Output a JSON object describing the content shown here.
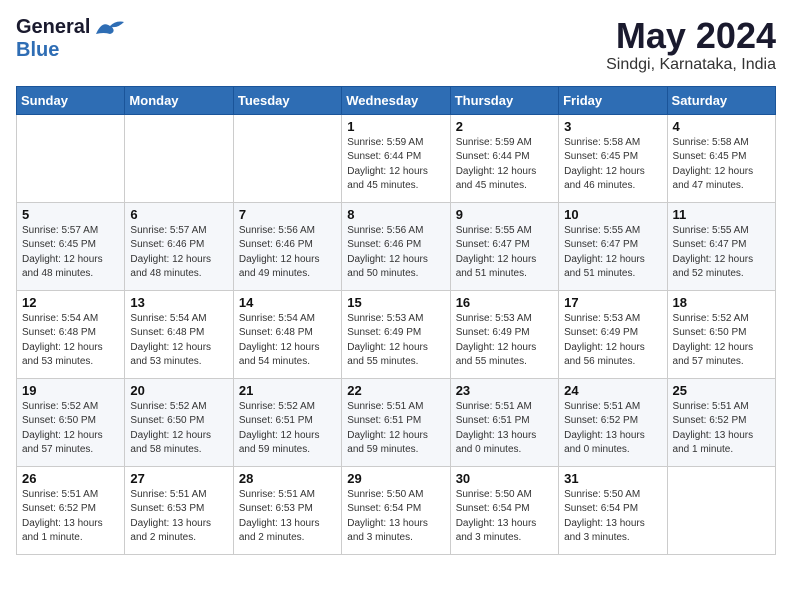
{
  "header": {
    "logo_general": "General",
    "logo_blue": "Blue",
    "month_title": "May 2024",
    "location": "Sindgi, Karnataka, India"
  },
  "days_of_week": [
    "Sunday",
    "Monday",
    "Tuesday",
    "Wednesday",
    "Thursday",
    "Friday",
    "Saturday"
  ],
  "weeks": [
    [
      {
        "day": "",
        "info": ""
      },
      {
        "day": "",
        "info": ""
      },
      {
        "day": "",
        "info": ""
      },
      {
        "day": "1",
        "info": "Sunrise: 5:59 AM\nSunset: 6:44 PM\nDaylight: 12 hours\nand 45 minutes."
      },
      {
        "day": "2",
        "info": "Sunrise: 5:59 AM\nSunset: 6:44 PM\nDaylight: 12 hours\nand 45 minutes."
      },
      {
        "day": "3",
        "info": "Sunrise: 5:58 AM\nSunset: 6:45 PM\nDaylight: 12 hours\nand 46 minutes."
      },
      {
        "day": "4",
        "info": "Sunrise: 5:58 AM\nSunset: 6:45 PM\nDaylight: 12 hours\nand 47 minutes."
      }
    ],
    [
      {
        "day": "5",
        "info": "Sunrise: 5:57 AM\nSunset: 6:45 PM\nDaylight: 12 hours\nand 48 minutes."
      },
      {
        "day": "6",
        "info": "Sunrise: 5:57 AM\nSunset: 6:46 PM\nDaylight: 12 hours\nand 48 minutes."
      },
      {
        "day": "7",
        "info": "Sunrise: 5:56 AM\nSunset: 6:46 PM\nDaylight: 12 hours\nand 49 minutes."
      },
      {
        "day": "8",
        "info": "Sunrise: 5:56 AM\nSunset: 6:46 PM\nDaylight: 12 hours\nand 50 minutes."
      },
      {
        "day": "9",
        "info": "Sunrise: 5:55 AM\nSunset: 6:47 PM\nDaylight: 12 hours\nand 51 minutes."
      },
      {
        "day": "10",
        "info": "Sunrise: 5:55 AM\nSunset: 6:47 PM\nDaylight: 12 hours\nand 51 minutes."
      },
      {
        "day": "11",
        "info": "Sunrise: 5:55 AM\nSunset: 6:47 PM\nDaylight: 12 hours\nand 52 minutes."
      }
    ],
    [
      {
        "day": "12",
        "info": "Sunrise: 5:54 AM\nSunset: 6:48 PM\nDaylight: 12 hours\nand 53 minutes."
      },
      {
        "day": "13",
        "info": "Sunrise: 5:54 AM\nSunset: 6:48 PM\nDaylight: 12 hours\nand 53 minutes."
      },
      {
        "day": "14",
        "info": "Sunrise: 5:54 AM\nSunset: 6:48 PM\nDaylight: 12 hours\nand 54 minutes."
      },
      {
        "day": "15",
        "info": "Sunrise: 5:53 AM\nSunset: 6:49 PM\nDaylight: 12 hours\nand 55 minutes."
      },
      {
        "day": "16",
        "info": "Sunrise: 5:53 AM\nSunset: 6:49 PM\nDaylight: 12 hours\nand 55 minutes."
      },
      {
        "day": "17",
        "info": "Sunrise: 5:53 AM\nSunset: 6:49 PM\nDaylight: 12 hours\nand 56 minutes."
      },
      {
        "day": "18",
        "info": "Sunrise: 5:52 AM\nSunset: 6:50 PM\nDaylight: 12 hours\nand 57 minutes."
      }
    ],
    [
      {
        "day": "19",
        "info": "Sunrise: 5:52 AM\nSunset: 6:50 PM\nDaylight: 12 hours\nand 57 minutes."
      },
      {
        "day": "20",
        "info": "Sunrise: 5:52 AM\nSunset: 6:50 PM\nDaylight: 12 hours\nand 58 minutes."
      },
      {
        "day": "21",
        "info": "Sunrise: 5:52 AM\nSunset: 6:51 PM\nDaylight: 12 hours\nand 59 minutes."
      },
      {
        "day": "22",
        "info": "Sunrise: 5:51 AM\nSunset: 6:51 PM\nDaylight: 12 hours\nand 59 minutes."
      },
      {
        "day": "23",
        "info": "Sunrise: 5:51 AM\nSunset: 6:51 PM\nDaylight: 13 hours\nand 0 minutes."
      },
      {
        "day": "24",
        "info": "Sunrise: 5:51 AM\nSunset: 6:52 PM\nDaylight: 13 hours\nand 0 minutes."
      },
      {
        "day": "25",
        "info": "Sunrise: 5:51 AM\nSunset: 6:52 PM\nDaylight: 13 hours\nand 1 minute."
      }
    ],
    [
      {
        "day": "26",
        "info": "Sunrise: 5:51 AM\nSunset: 6:52 PM\nDaylight: 13 hours\nand 1 minute."
      },
      {
        "day": "27",
        "info": "Sunrise: 5:51 AM\nSunset: 6:53 PM\nDaylight: 13 hours\nand 2 minutes."
      },
      {
        "day": "28",
        "info": "Sunrise: 5:51 AM\nSunset: 6:53 PM\nDaylight: 13 hours\nand 2 minutes."
      },
      {
        "day": "29",
        "info": "Sunrise: 5:50 AM\nSunset: 6:54 PM\nDaylight: 13 hours\nand 3 minutes."
      },
      {
        "day": "30",
        "info": "Sunrise: 5:50 AM\nSunset: 6:54 PM\nDaylight: 13 hours\nand 3 minutes."
      },
      {
        "day": "31",
        "info": "Sunrise: 5:50 AM\nSunset: 6:54 PM\nDaylight: 13 hours\nand 3 minutes."
      },
      {
        "day": "",
        "info": ""
      }
    ]
  ]
}
